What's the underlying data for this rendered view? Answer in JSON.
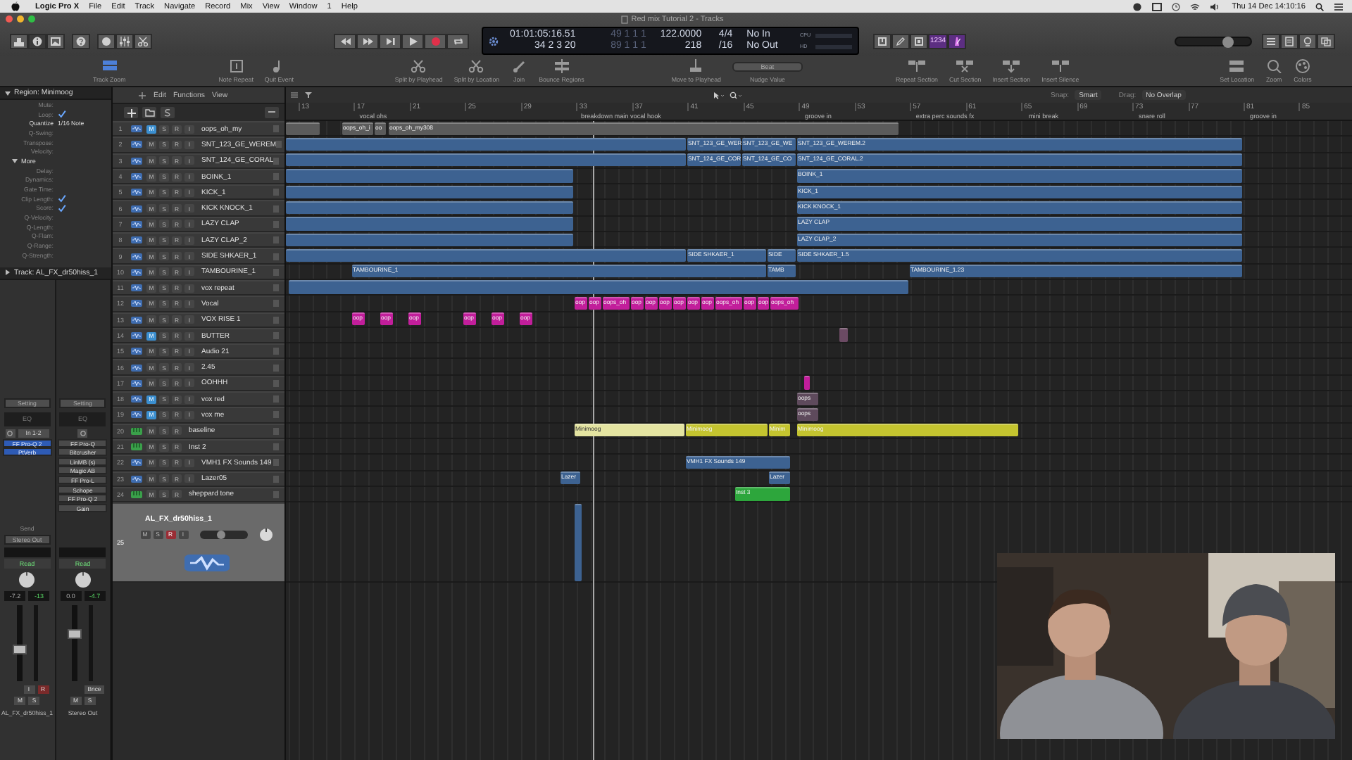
{
  "menu_bar": {
    "app": "Logic Pro X",
    "items": [
      "File",
      "Edit",
      "Track",
      "Navigate",
      "Record",
      "Mix",
      "View",
      "Window",
      "1",
      "Help"
    ],
    "clock": "Thu 14 Dec 14:10:16"
  },
  "window": {
    "title": "Red mix Tutorial 2 - Tracks"
  },
  "control_bar": {
    "lcd": {
      "time": "01:01:05:16.51",
      "bars": "34 2 3 20",
      "locator_start": "49 1 1 1",
      "locator_end": "89 1 1 1",
      "tempo": "122.0000",
      "tempo_sub": "218",
      "signature": "4/4",
      "division": "/16",
      "input": "No In",
      "output": "No Out",
      "cpu": "CPU",
      "hd": "HD"
    },
    "count_in": "1234",
    "master_volume": {
      "level": 0.7
    }
  },
  "toolbar": {
    "tools": [
      {
        "label": "Track Zoom",
        "kind": "button",
        "selected": true
      },
      {
        "label": "Note Repeat",
        "kind": "button",
        "selected": false
      },
      {
        "label": "Quit Event",
        "kind": "button",
        "selected": false
      },
      {
        "label": "Split by Playhead",
        "kind": "button",
        "selected": false
      },
      {
        "label": "Split by Location",
        "kind": "button",
        "selected": false
      },
      {
        "label": "Join",
        "kind": "button",
        "selected": false
      },
      {
        "label": "Bounce Regions",
        "kind": "button",
        "selected": false
      },
      {
        "label": "Move to Playhead",
        "kind": "button",
        "selected": false
      },
      {
        "label": "Nudge Value",
        "kind": "dropdown",
        "value": "Beat",
        "selected": false
      },
      {
        "label": "Repeat Section",
        "kind": "button",
        "selected": false
      },
      {
        "label": "Cut Section",
        "kind": "button",
        "selected": false
      },
      {
        "label": "Insert Section",
        "kind": "button",
        "selected": false
      },
      {
        "label": "Insert Silence",
        "kind": "button",
        "selected": false
      },
      {
        "label": "Set Location",
        "kind": "button",
        "selected": false
      },
      {
        "label": "Zoom",
        "kind": "button",
        "selected": false
      },
      {
        "label": "Colors",
        "kind": "button",
        "selected": false
      }
    ]
  },
  "inspector": {
    "region": {
      "title": "Region: Minimoog",
      "expanded": true,
      "params": [
        {
          "label": "Mute:",
          "kind": "plain"
        },
        {
          "label": "Loop:",
          "kind": "check",
          "checked": true
        },
        {
          "label": "Quantize",
          "kind": "value",
          "value": "1/16 Note"
        },
        {
          "label": "Q-Swing:",
          "kind": "plain"
        },
        {
          "label": "Transpose:",
          "kind": "plain"
        },
        {
          "label": "Velocity:",
          "kind": "plain"
        }
      ],
      "more": {
        "title": "More",
        "expanded": true,
        "params": [
          {
            "label": "Delay:",
            "kind": "plain"
          },
          {
            "label": "Dynamics:",
            "kind": "plain"
          },
          {
            "label": "Gate Time:",
            "kind": "plain"
          },
          {
            "label": "Clip Length:",
            "kind": "check",
            "checked": true
          },
          {
            "label": "Score:",
            "kind": "check",
            "checked": true
          },
          {
            "label": "Q-Velocity:",
            "kind": "plain"
          },
          {
            "label": "Q-Length:",
            "kind": "plain"
          },
          {
            "label": "Q-Flam:",
            "kind": "plain"
          },
          {
            "label": "Q-Range:",
            "kind": "plain"
          },
          {
            "label": "Q-Strength:",
            "kind": "plain"
          }
        ]
      }
    },
    "track": {
      "title": "Track: AL_FX_dr50hiss_1",
      "expanded": false
    },
    "strips": [
      {
        "setting": "Setting",
        "eq": "EQ",
        "input": "In 1-2",
        "inserts": [
          "FF Pro-Q 2",
          "PtVerb"
        ],
        "send": "Send",
        "output": "Stereo Out",
        "automation": "Read",
        "volume": "-7.2",
        "peak": "-13",
        "fader": {
          "level": 0.4
        },
        "rec_buttons": [
          "I",
          "R"
        ],
        "buttons": [
          "M",
          "S"
        ],
        "name": "AL_FX_dr50hiss_1",
        "selected": true
      },
      {
        "setting": "Setting",
        "eq": "EQ",
        "inserts": [
          "FF Pro-Q",
          "Bitcrusher",
          "LinMB (s)",
          "Magic AB",
          "FF Pro-L",
          "Schope",
          "FF Pro-Q 2",
          "Gain"
        ],
        "automation": "Read",
        "volume": "0.0",
        "peak": "-4.7",
        "fader": {
          "level": 0.62
        },
        "bounce": "Bnce",
        "buttons": [
          "M",
          "S"
        ],
        "name": "Stereo Out",
        "selected": false
      }
    ]
  },
  "track_list": {
    "menus": [
      "Edit",
      "Functions",
      "View"
    ]
  },
  "arrange": {
    "snap_label": "Snap:",
    "snap": "Smart",
    "drag_label": "Drag:",
    "drag": "No Overlap",
    "bars": [
      "13",
      "17",
      "21",
      "25",
      "29",
      "33",
      "37",
      "41",
      "45",
      "49",
      "53",
      "57",
      "61",
      "65",
      "69",
      "73",
      "77",
      "81",
      "85"
    ],
    "markers": [
      "vocal ohs",
      "breakdown main vocal hook",
      "groove in",
      "extra perc sounds fx",
      "mini break",
      "snare roll",
      "groove in"
    ]
  },
  "tracks": [
    {
      "number": "1",
      "name": "oops_oh_my",
      "kind": "audio",
      "muted": true,
      "armed": false,
      "selected": false,
      "buttons": [
        "M",
        "S",
        "R",
        "I"
      ],
      "color": "#5b5b5b",
      "regions": [
        {
          "selected": false
        },
        {
          "name": "oops_oh_i",
          "selected": false
        },
        {
          "name": "oo",
          "selected": false
        },
        {
          "name": "oops_oh_my308",
          "selected": false
        }
      ]
    },
    {
      "number": "2",
      "name": "SNT_123_GE_WEREM",
      "kind": "audio",
      "muted": false,
      "armed": false,
      "selected": false,
      "buttons": [
        "M",
        "S",
        "R",
        "I"
      ],
      "color": "#3d6291",
      "regions": [
        {
          "selected": false
        },
        {
          "name": "SNT_123_GE_WER",
          "selected": false
        },
        {
          "name": "SNT_123_GE_WE",
          "selected": false
        },
        {
          "name": "SNT_123_GE_WEREM.2",
          "selected": false
        }
      ]
    },
    {
      "number": "3",
      "name": "SNT_124_GE_CORAL",
      "kind": "audio",
      "muted": false,
      "armed": false,
      "selected": false,
      "buttons": [
        "M",
        "S",
        "R",
        "I"
      ],
      "color": "#3d6291",
      "regions": [
        {
          "selected": false
        },
        {
          "name": "SNT_124_GE_COR",
          "selected": false
        },
        {
          "name": "SNT_124_GE_CO",
          "selected": false
        },
        {
          "name": "SNT_124_GE_CORAL.2",
          "selected": false
        }
      ]
    },
    {
      "number": "4",
      "name": "BOINK_1",
      "kind": "audio",
      "muted": false,
      "armed": false,
      "selected": false,
      "buttons": [
        "M",
        "S",
        "R",
        "I"
      ],
      "color": "#3d6291",
      "regions": [
        {
          "selected": false
        },
        {
          "name": "BOINK_1",
          "selected": false
        }
      ]
    },
    {
      "number": "5",
      "name": "KICK_1",
      "kind": "audio",
      "muted": false,
      "armed": false,
      "selected": false,
      "buttons": [
        "M",
        "S",
        "R",
        "I"
      ],
      "color": "#3d6291",
      "regions": [
        {
          "selected": false
        },
        {
          "name": "KICK_1",
          "selected": false
        }
      ]
    },
    {
      "number": "6",
      "name": "KICK KNOCK_1",
      "kind": "audio",
      "muted": false,
      "armed": false,
      "selected": false,
      "buttons": [
        "M",
        "S",
        "R",
        "I"
      ],
      "color": "#3d6291",
      "regions": [
        {
          "selected": false
        },
        {
          "name": "KICK KNOCK_1",
          "selected": false
        }
      ]
    },
    {
      "number": "7",
      "name": "LAZY CLAP",
      "kind": "audio",
      "muted": false,
      "armed": false,
      "selected": false,
      "buttons": [
        "M",
        "S",
        "R",
        "I"
      ],
      "color": "#3d6291",
      "regions": [
        {
          "selected": false
        },
        {
          "name": "LAZY CLAP",
          "selected": false
        }
      ]
    },
    {
      "number": "8",
      "name": "LAZY CLAP_2",
      "kind": "audio",
      "muted": false,
      "armed": false,
      "selected": false,
      "buttons": [
        "M",
        "S",
        "R",
        "I"
      ],
      "color": "#3d6291",
      "regions": [
        {
          "selected": false
        },
        {
          "name": "LAZY CLAP_2",
          "selected": false
        }
      ]
    },
    {
      "number": "9",
      "name": "SIDE SHKAER_1",
      "kind": "audio",
      "muted": false,
      "armed": false,
      "selected": false,
      "buttons": [
        "M",
        "S",
        "R",
        "I"
      ],
      "color": "#3d6291",
      "regions": [
        {
          "selected": false
        },
        {
          "name": "SIDE SHKAER_1",
          "selected": false
        },
        {
          "name": "SIDE",
          "selected": false
        },
        {
          "name": "SIDE SHKAER_1.5",
          "selected": false
        }
      ]
    },
    {
      "number": "10",
      "name": "TAMBOURINE_1",
      "kind": "audio",
      "muted": false,
      "armed": false,
      "selected": false,
      "buttons": [
        "M",
        "S",
        "R",
        "I"
      ],
      "color": "#3d6291",
      "regions": [
        {
          "name": "TAMBOURINE_1",
          "selected": false
        },
        {
          "name": "TAMB",
          "selected": false
        },
        {
          "name": "TAMBOURINE_1.23",
          "selected": false
        }
      ]
    },
    {
      "number": "11",
      "name": "vox repeat",
      "kind": "audio",
      "muted": false,
      "armed": false,
      "selected": false,
      "buttons": [
        "M",
        "S",
        "R",
        "I"
      ],
      "color": "#3d6291",
      "regions": [
        {
          "selected": false
        }
      ]
    },
    {
      "number": "12",
      "name": "Vocal",
      "kind": "audio",
      "muted": false,
      "armed": false,
      "selected": false,
      "buttons": [
        "M",
        "S",
        "R",
        "I"
      ],
      "color": "#c21e9b",
      "regions": [
        {
          "name": "oop",
          "selected": false
        },
        {
          "name": "oop",
          "selected": false
        },
        {
          "name": "oops_oh",
          "selected": false
        },
        {
          "name": "oop",
          "selected": false
        },
        {
          "name": "oop",
          "selected": false
        },
        {
          "name": "oop",
          "selected": false
        },
        {
          "name": "oop",
          "selected": false
        },
        {
          "name": "oop",
          "selected": false
        },
        {
          "name": "oop",
          "selected": false
        },
        {
          "name": "oops_oh",
          "selected": false
        },
        {
          "name": "oop",
          "selected": false
        },
        {
          "name": "oop",
          "selected": false
        },
        {
          "name": "oops_oh",
          "selected": false
        }
      ]
    },
    {
      "number": "13",
      "name": "VOX RISE 1",
      "kind": "audio",
      "muted": false,
      "armed": false,
      "selected": false,
      "buttons": [
        "M",
        "S",
        "R",
        "I"
      ],
      "color": "#c21e9b",
      "regions": [
        {
          "name": "oop",
          "selected": false
        },
        {
          "name": "oop",
          "selected": false
        },
        {
          "name": "oop",
          "selected": false
        },
        {
          "name": "oop",
          "selected": false
        },
        {
          "name": "oop",
          "selected": false
        },
        {
          "name": "oop",
          "selected": false
        }
      ]
    },
    {
      "number": "14",
      "name": "BUTTER",
      "kind": "audio",
      "muted": true,
      "armed": false,
      "selected": false,
      "buttons": [
        "M",
        "S",
        "R",
        "I"
      ],
      "color": "#6b4a63",
      "regions": [
        {
          "selected": false
        }
      ]
    },
    {
      "number": "15",
      "name": "Audio 21",
      "kind": "audio",
      "muted": false,
      "armed": false,
      "selected": false,
      "buttons": [
        "M",
        "S",
        "R",
        "I"
      ]
    },
    {
      "number": "16",
      "name": "2.45",
      "kind": "audio",
      "muted": false,
      "armed": false,
      "selected": false,
      "buttons": [
        "M",
        "S",
        "R",
        "I"
      ]
    },
    {
      "number": "17",
      "name": "OOHHH",
      "kind": "audio",
      "muted": false,
      "armed": false,
      "selected": false,
      "buttons": [
        "M",
        "S",
        "R",
        "I"
      ],
      "color": "#c21e9b",
      "regions": [
        {
          "selected": false
        }
      ]
    },
    {
      "number": "18",
      "name": "vox red",
      "kind": "audio",
      "muted": true,
      "armed": false,
      "selected": false,
      "buttons": [
        "M",
        "S",
        "R",
        "I"
      ],
      "color": "#5e4a5c",
      "regions": [
        {
          "name": "oops",
          "selected": false
        }
      ]
    },
    {
      "number": "19",
      "name": "vox me",
      "kind": "audio",
      "muted": true,
      "armed": false,
      "selected": false,
      "buttons": [
        "M",
        "S",
        "R",
        "I"
      ],
      "color": "#5e4a5c",
      "regions": [
        {
          "name": "oops",
          "selected": false
        }
      ]
    },
    {
      "number": "20",
      "name": "baseline",
      "kind": "instrument",
      "muted": false,
      "armed": false,
      "selected": false,
      "buttons": [
        "M",
        "S",
        "R"
      ],
      "color": "#c4c42f",
      "regions": [
        {
          "name": "Minimoog",
          "selected": true
        },
        {
          "name": "Minimoog",
          "selected": false
        },
        {
          "name": "Minim",
          "selected": false
        },
        {
          "name": "Minimoog",
          "selected": false
        }
      ]
    },
    {
      "number": "21",
      "name": "Inst 2",
      "kind": "instrument",
      "muted": false,
      "armed": false,
      "selected": false,
      "buttons": [
        "M",
        "S",
        "R"
      ]
    },
    {
      "number": "22",
      "name": "VMH1 FX Sounds 149",
      "kind": "audio",
      "muted": false,
      "armed": false,
      "selected": false,
      "buttons": [
        "M",
        "S",
        "R",
        "I"
      ],
      "color": "#3d6291",
      "regions": [
        {
          "name": "VMH1 FX Sounds 149",
          "selected": false
        }
      ]
    },
    {
      "number": "23",
      "name": "Lazer05",
      "kind": "audio",
      "muted": false,
      "armed": false,
      "selected": false,
      "buttons": [
        "M",
        "S",
        "R",
        "I"
      ],
      "color": "#3d6291",
      "regions": [
        {
          "name": "Lazer",
          "selected": false
        },
        {
          "name": "Lazer",
          "selected": false
        }
      ]
    },
    {
      "number": "24",
      "name": "sheppard tone",
      "kind": "instrument",
      "muted": false,
      "armed": false,
      "selected": false,
      "buttons": [
        "M",
        "S",
        "R"
      ],
      "color": "#2da63c",
      "regions": [
        {
          "name": "Inst 3",
          "selected": false
        }
      ]
    },
    {
      "number": "25",
      "name": "AL_FX_dr50hiss_1",
      "kind": "audio",
      "muted": false,
      "armed": true,
      "selected": true,
      "buttons": [
        "M",
        "S",
        "R",
        "I"
      ],
      "volume": {
        "level": 0.45
      },
      "color": "#3d6291",
      "regions": [
        {
          "selected": false
        }
      ]
    }
  ]
}
